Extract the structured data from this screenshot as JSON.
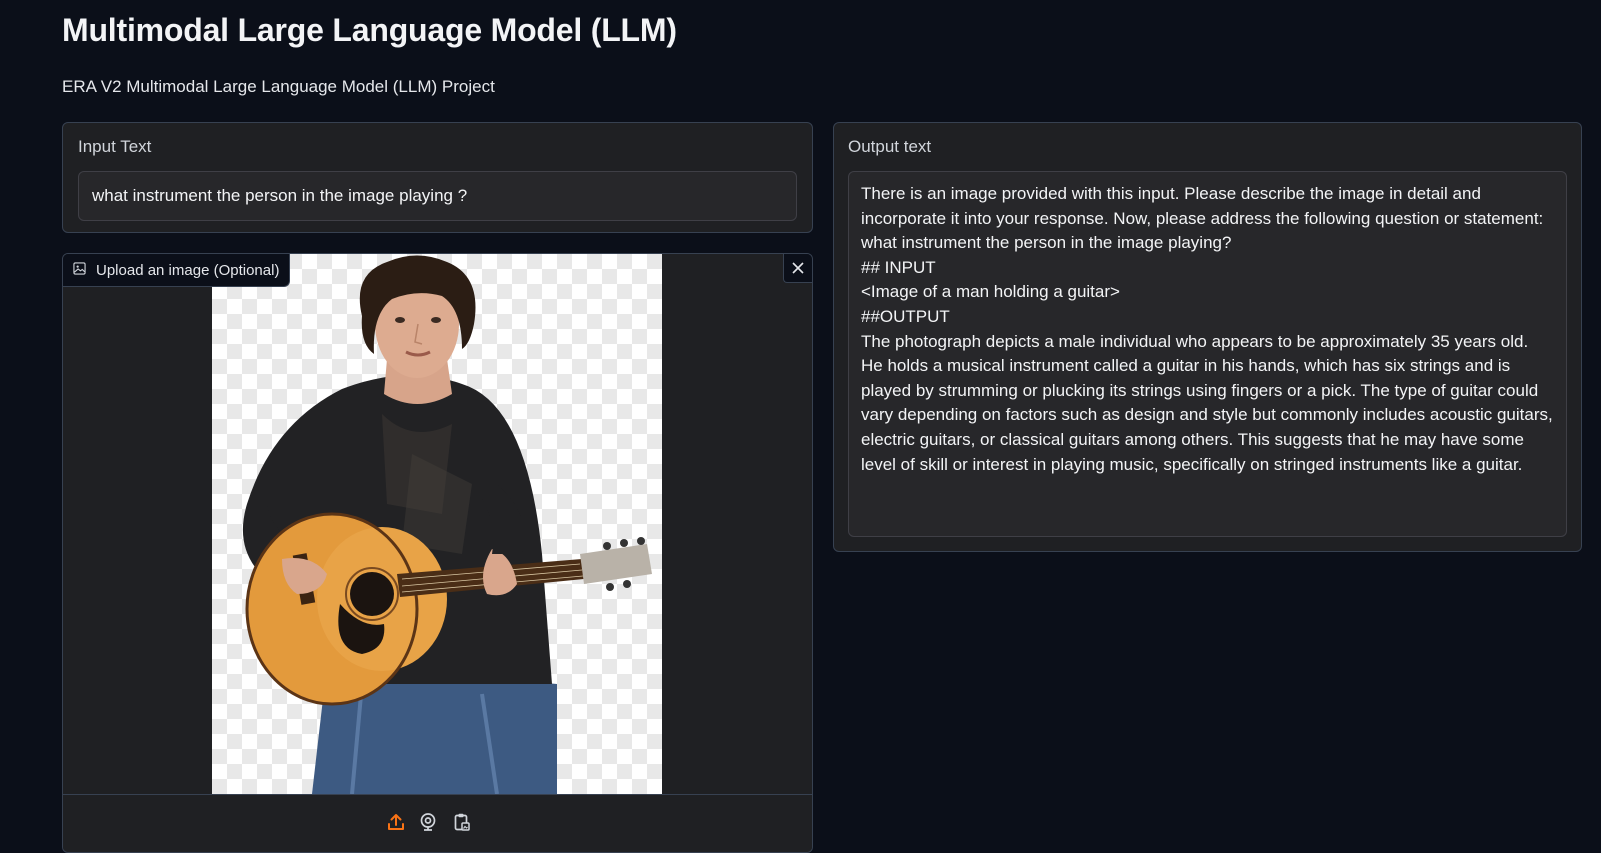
{
  "header": {
    "title": "Multimodal Large Language Model (LLM)",
    "description": "ERA V2 Multimodal Large Language Model (LLM) Project"
  },
  "input": {
    "label": "Input Text",
    "value": "what instrument the person in the image playing ?"
  },
  "image_upload": {
    "label": "Upload an image (Optional)",
    "icons": [
      "image-icon",
      "close-icon",
      "upload-icon",
      "webcam-icon",
      "clipboard-icon"
    ],
    "accent_color": "#f97316"
  },
  "output": {
    "label": "Output text",
    "value": "There is an image provided with this input. Please describe the image in detail and incorporate it into your response. Now, please address the following question or statement: what instrument the person in the image playing?\n## INPUT\n<Image of a man holding a guitar>\n##OUTPUT\nThe photograph depicts a male individual who appears to be approximately 35 years old. He holds a musical instrument called a guitar in his hands, which has six strings and is played by strumming or plucking its strings using fingers or a pick. The type of guitar could vary depending on factors such as design and style but commonly includes acoustic guitars, electric guitars, or classical guitars among others. This suggests that he may have some level of skill or interest in playing music, specifically on stringed instruments like a guitar."
  },
  "colors": {
    "background": "#0b0f19",
    "panel": "#1f2023",
    "field": "#27272a",
    "accent": "#f97316"
  }
}
